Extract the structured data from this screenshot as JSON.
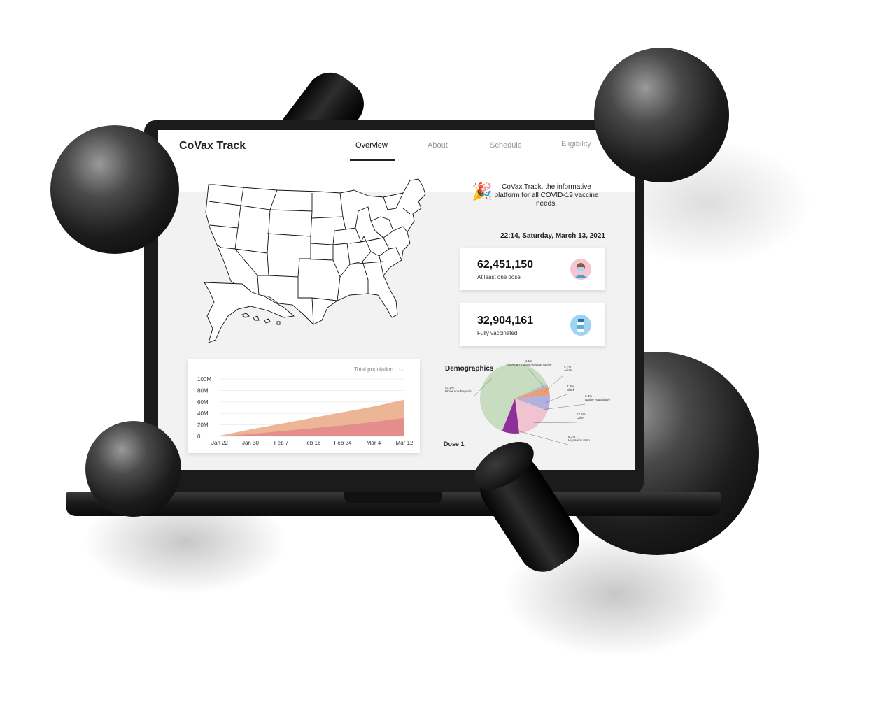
{
  "app": {
    "title": "CoVax Track"
  },
  "nav": [
    {
      "label": "Overview",
      "active": true
    },
    {
      "label": "About",
      "active": false
    },
    {
      "label": "Schedule",
      "active": false
    },
    {
      "label": "Eligibility",
      "active": false
    }
  ],
  "intro": {
    "icon": "party-popper-icon",
    "text": "CoVax Track, the informative platform for all COVID-19 vaccine needs."
  },
  "datetime": "22:14, Saturday, March 13, 2021",
  "stats": [
    {
      "number": "62,451,150",
      "label": "At least one dose",
      "icon": "masked-person-icon",
      "icon_bg": "#f5c6d0"
    },
    {
      "number": "32,904,161",
      "label": "Fully vaccinated",
      "icon": "vaccine-vial-icon",
      "icon_bg": "#9fd3f2"
    }
  ],
  "area_chart": {
    "dropdown_label": "Total population",
    "dropdown_icon": "chevron-down-icon"
  },
  "demographics": {
    "title": "Demographics",
    "dose_label": "Dose 1"
  },
  "chart_data": [
    {
      "type": "area",
      "x": [
        "Jan 22",
        "Jan 30",
        "Feb 7",
        "Feb 16",
        "Feb 24",
        "Mar 4",
        "Mar 12"
      ],
      "ylim": [
        0,
        100
      ],
      "yticks": [
        "0",
        "20M",
        "40M",
        "60M",
        "80M",
        "100M"
      ],
      "series": [
        {
          "values": [
            1,
            12,
            22,
            32,
            42,
            52,
            64
          ],
          "color": "#ebb596"
        },
        {
          "values": [
            0,
            4,
            9,
            14,
            19,
            25,
            32
          ],
          "color": "#e58d8d"
        }
      ]
    },
    {
      "type": "pie",
      "slices": [
        {
          "label": "White non-hispanic",
          "pct_label": "63.2%",
          "value": 63.2,
          "color": "#c8dcbf"
        },
        {
          "label": "American Indian/ Alaskan Native",
          "pct_label": "1.1%",
          "value": 1.1,
          "color": "#9ec6e6"
        },
        {
          "label": "Asian",
          "pct_label": "4.7%",
          "value": 4.7,
          "color": "#e8a07a"
        },
        {
          "label": "Black",
          "pct_label": "7.2%",
          "value": 7.2,
          "color": "#b3b0dd"
        },
        {
          "label": "Native Hawaiian/ Other pacific islander",
          "pct_label": "0.3%",
          "value": 0.3,
          "color": "#d8c8e8"
        },
        {
          "label": "Other",
          "pct_label": "17.5%",
          "value": 17.5,
          "color": "#f1c2d0"
        },
        {
          "label": "Hispanic/Latino",
          "pct_label": "8.1%",
          "value": 8.1,
          "color": "#8e2f9a"
        }
      ]
    }
  ]
}
